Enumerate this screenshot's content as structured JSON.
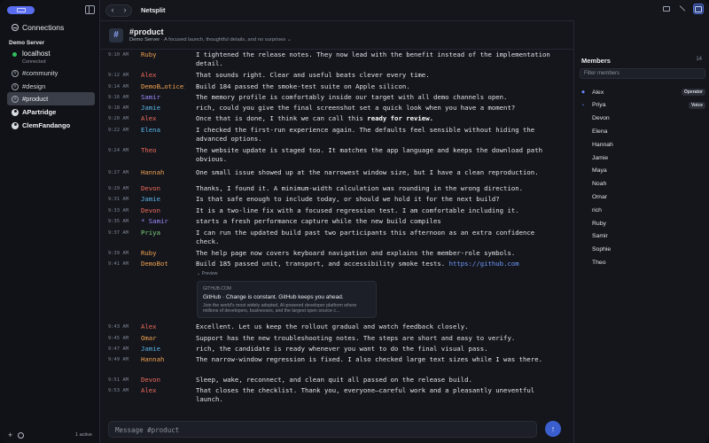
{
  "app": {
    "title": "Netsplit"
  },
  "sidebar": {
    "connections_label": "Connections",
    "server_name": "Demo Server",
    "localhost": {
      "name": "localhost",
      "status": "Connected"
    },
    "items": [
      {
        "label": "#community",
        "kind": "channel"
      },
      {
        "label": "#design",
        "kind": "channel"
      },
      {
        "label": "#product",
        "kind": "channel",
        "active": true
      },
      {
        "label": "APartridge",
        "kind": "user"
      },
      {
        "label": "ClemFandango",
        "kind": "user"
      }
    ],
    "active_count": "1 active"
  },
  "channel": {
    "icon": "#",
    "name": "#product",
    "server": "Demo Server",
    "topic": "A focused launch, thoughtful details, and no surprises"
  },
  "messages": [
    {
      "time": "9:10 AM",
      "nick": "Ruby",
      "color": "#f0a050",
      "text": "I tightened the release notes. They now lead with the benefit instead of the implementation detail."
    },
    {
      "time": "9:12 AM",
      "nick": "Alex",
      "color": "#ef6a5a",
      "text": "That sounds right. Clear and useful beats clever every time."
    },
    {
      "time": "9:14 AM",
      "nick": "DemoB…otice)",
      "color": "#f0a050",
      "text": "Build 184 passed the smoke-test suite on Apple silicon."
    },
    {
      "time": "9:16 AM",
      "nick": "Samir",
      "color": "#9b8cff",
      "text": "The memory profile is comfortably inside our target with all demo channels open."
    },
    {
      "time": "9:18 AM",
      "nick": "Jamie",
      "color": "#5ab4e8",
      "text": "rich, could you give the final screenshot set a quick look when you have a moment?"
    },
    {
      "time": "9:20 AM",
      "nick": "Alex",
      "color": "#ef6a5a",
      "text_before": "Once that is done, I think we can call this ",
      "text_bold": "ready for review."
    },
    {
      "time": "9:22 AM",
      "nick": "Elena",
      "color": "#5ab4e8",
      "text": "I checked the first-run experience again. The defaults feel sensible without hiding the advanced options."
    },
    {
      "time": "9:24 AM",
      "nick": "Theo",
      "color": "#ef6a5a",
      "text": "The website update is staged too. It matches the app language and keeps the download path obvious."
    },
    {
      "time": "9:27 AM",
      "nick": "Hannah",
      "color": "#f0a050",
      "text": "One small issue showed up at the narrowest window size, but I have a clean reproduction."
    },
    {
      "time": "9:29 AM",
      "nick": "Devon",
      "color": "#ef6a5a",
      "text": "Thanks, I found it. A minimum-width calculation was rounding in the wrong direction."
    },
    {
      "time": "9:31 AM",
      "nick": "Jamie",
      "color": "#5ab4e8",
      "text": "Is that safe enough to include today, or should we hold it for the next build?"
    },
    {
      "time": "9:33 AM",
      "nick": "Devon",
      "color": "#ef6a5a",
      "text": "It is a two-line fix with a focused regression test. I am comfortable including it."
    },
    {
      "time": "9:35 AM",
      "nick": "* Samir",
      "color": "#9b8cff",
      "text": "starts a fresh performance capture while the new build compiles"
    },
    {
      "time": "9:37 AM",
      "nick": "Priya",
      "color": "#7ed07a",
      "text": "I can run the updated build past two participants this afternoon as an extra confidence check."
    },
    {
      "time": "9:39 AM",
      "nick": "Ruby",
      "color": "#f0a050",
      "text": "The help page now covers keyboard navigation and explains the member-role symbols."
    },
    {
      "time": "9:41 AM",
      "nick": "DemoBot",
      "color": "#f0a050",
      "text_before": "Build 185 passed unit, transport, and accessibility smoke tests. ",
      "link": "https://github.com"
    },
    {
      "time": "9:43 AM",
      "nick": "Alex",
      "color": "#ef6a5a",
      "text": "Excellent. Let us keep the rollout gradual and watch feedback closely."
    },
    {
      "time": "9:45 AM",
      "nick": "Omar",
      "color": "#f0a050",
      "text": "Support has the new troubleshooting notes. The steps are short and easy to verify."
    },
    {
      "time": "9:47 AM",
      "nick": "Jamie",
      "color": "#5ab4e8",
      "text": "rich, the candidate is ready whenever you want to do the final visual pass."
    },
    {
      "time": "9:49 AM",
      "nick": "Hannah",
      "color": "#f0a050",
      "text": "The narrow-window regression is fixed. I also checked large text sizes while I was there."
    },
    {
      "time": "9:51 AM",
      "nick": "Devon",
      "color": "#ef6a5a",
      "text": "Sleep, wake, reconnect, and clean quit all passed on the release build."
    },
    {
      "time": "9:53 AM",
      "nick": "Alex",
      "color": "#ef6a5a",
      "text": "That closes the checklist. Thank you, everyone—careful work and a pleasantly uneventful launch."
    }
  ],
  "preview": {
    "toggle": "Preview",
    "domain": "GITHUB.COM",
    "title": "GitHub · Change is constant. GitHub keeps you ahead.",
    "description": "Join the world's most widely adopted, AI-powered developer platform where millions of developers, businesses, and the largest open source c..."
  },
  "composer": {
    "placeholder": "Message #product"
  },
  "members": {
    "title": "Members",
    "count": "14",
    "filter_placeholder": "Filter members",
    "list": [
      {
        "name": "Alex",
        "badge": "Operator",
        "mark": "op"
      },
      {
        "name": "Priya",
        "badge": "Voice",
        "mark": "voice"
      },
      {
        "name": "Devon"
      },
      {
        "name": "Elena"
      },
      {
        "name": "Hannah"
      },
      {
        "name": "Jamie"
      },
      {
        "name": "Maya"
      },
      {
        "name": "Noah"
      },
      {
        "name": "Omar"
      },
      {
        "name": "rich"
      },
      {
        "name": "Ruby"
      },
      {
        "name": "Samir"
      },
      {
        "name": "Sophie"
      },
      {
        "name": "Theo"
      }
    ]
  }
}
